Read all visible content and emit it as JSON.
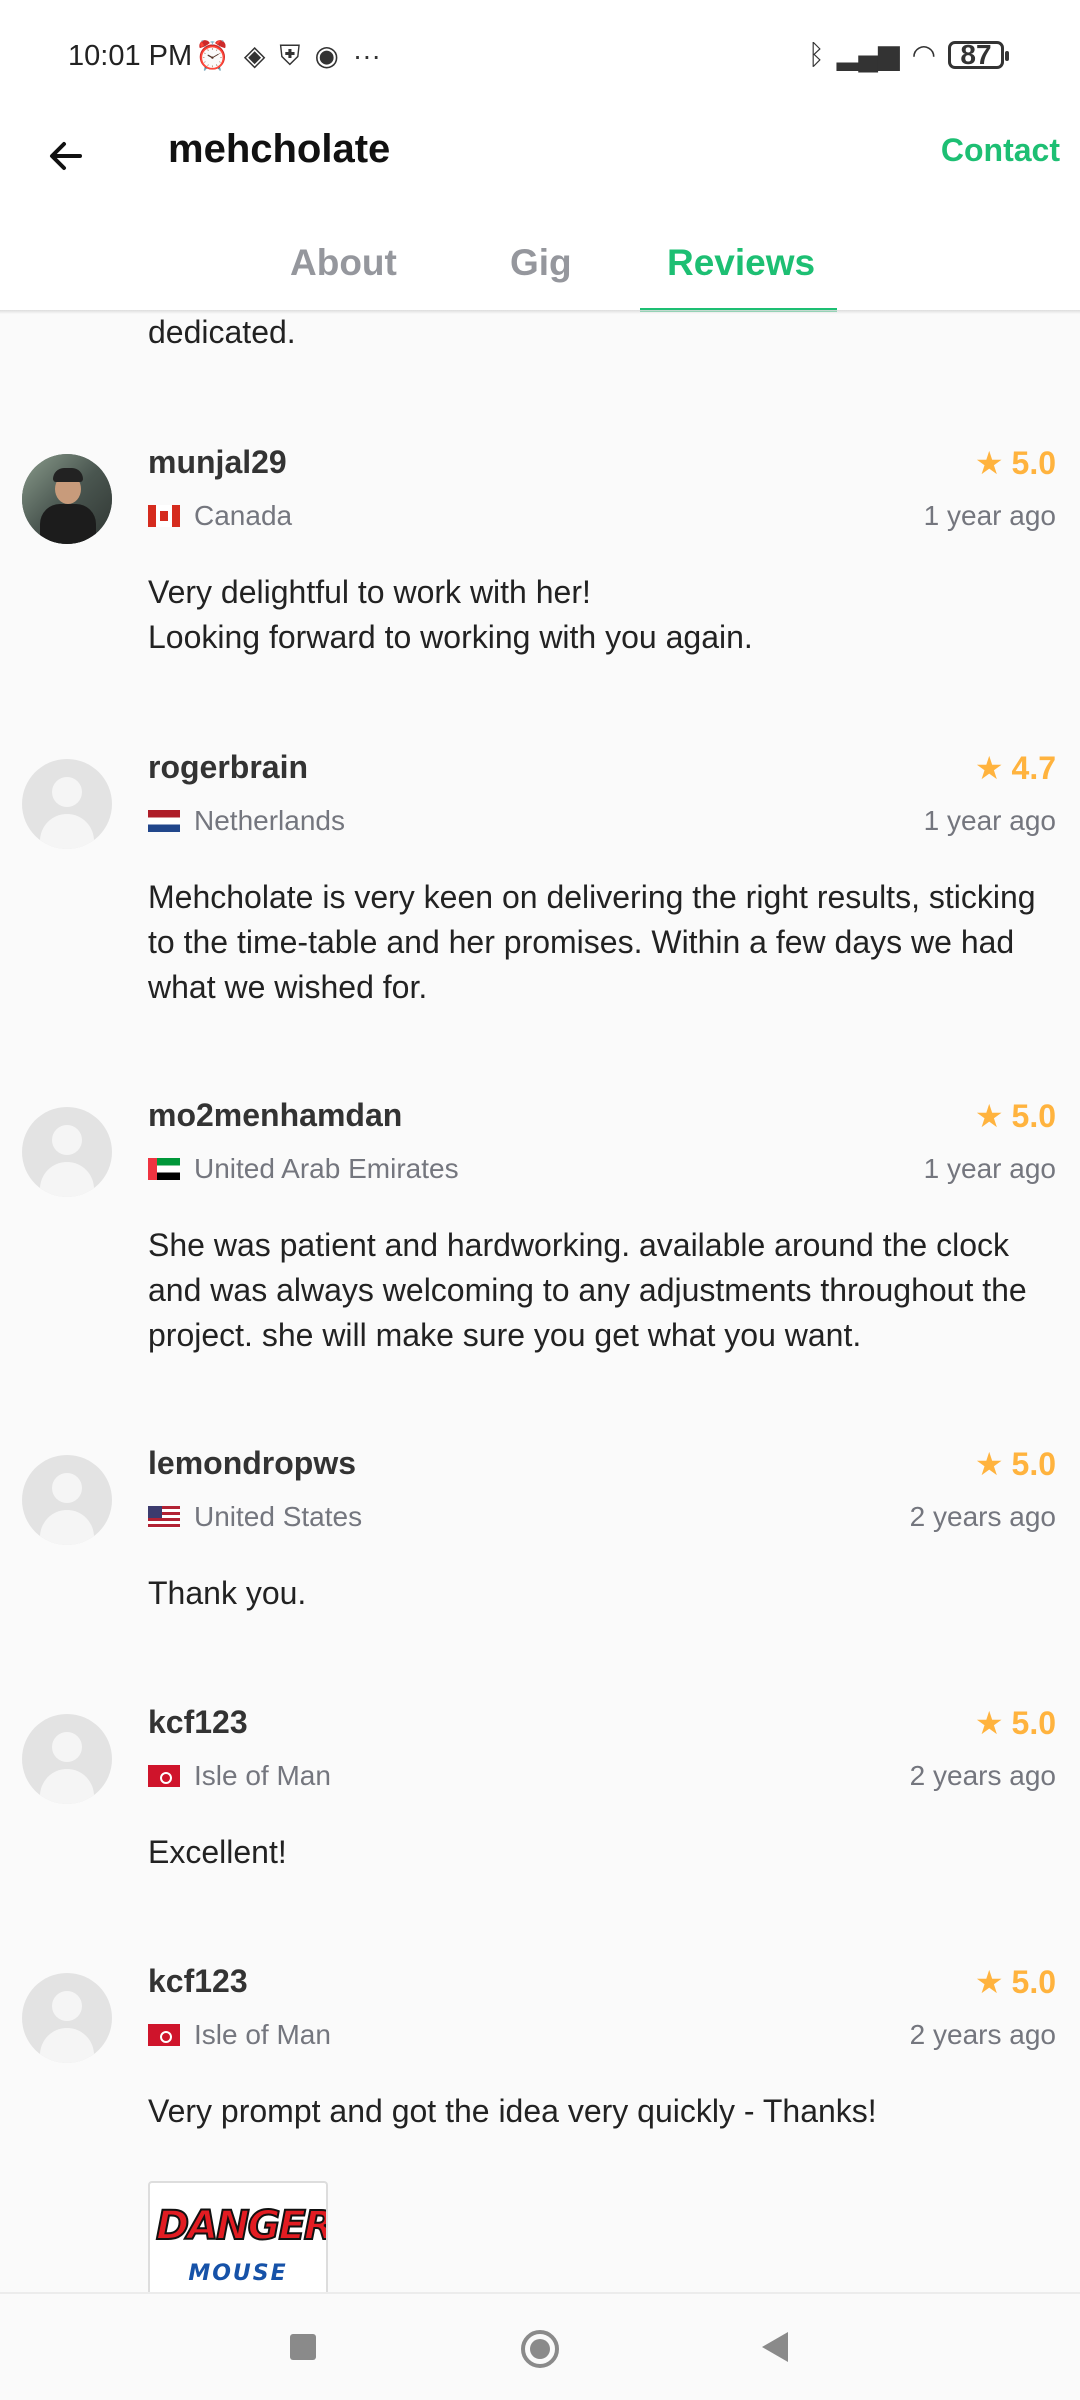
{
  "status_bar": {
    "time": "10:01 PM",
    "battery": "87",
    "icons_left": [
      "alarm-icon",
      "game-controller-icon",
      "shield-icon",
      "media-icon",
      "more-icon"
    ],
    "icons_right": [
      "bluetooth-icon",
      "signal-icon",
      "wifi-icon",
      "battery-icon"
    ]
  },
  "app_bar": {
    "title": "mehcholate",
    "contact_label": "Contact"
  },
  "tabs": [
    {
      "label": "About",
      "active": false
    },
    {
      "label": "Gig",
      "active": false
    },
    {
      "label": "Reviews",
      "active": true
    }
  ],
  "colors": {
    "accent": "#1dbf73",
    "star": "#ffb33e",
    "muted": "#74767e"
  },
  "partial_text": "dedicated.",
  "reviews": [
    {
      "username": "munjal29",
      "rating": "5.0",
      "country": "Canada",
      "time_ago": "1 year ago",
      "text": "Very delightful to work with her!\nLooking forward to working with you again.",
      "avatar": "photo"
    },
    {
      "username": "rogerbrain",
      "rating": "4.7",
      "country": "Netherlands",
      "time_ago": "1 year ago",
      "text": "Mehcholate is very keen on delivering the right results, sticking to the time-table and her promises. Within a few days we had what we wished for.",
      "avatar": "placeholder"
    },
    {
      "username": "mo2menhamdan",
      "rating": "5.0",
      "country": "United Arab Emirates",
      "time_ago": "1 year ago",
      "text": "She was patient and hardworking. available around the clock and was always welcoming to any adjustments throughout the project. she will make sure you get what you want.",
      "avatar": "placeholder"
    },
    {
      "username": "lemondropws",
      "rating": "5.0",
      "country": "United States",
      "time_ago": "2 years ago",
      "text": "Thank you.",
      "avatar": "placeholder"
    },
    {
      "username": "kcf123",
      "rating": "5.0",
      "country": "Isle of Man",
      "time_ago": "2 years ago",
      "text": "Excellent!",
      "avatar": "placeholder"
    },
    {
      "username": "kcf123",
      "rating": "5.0",
      "country": "Isle of Man",
      "time_ago": "2 years ago",
      "text": "Very prompt and got the idea very quickly - Thanks!",
      "avatar": "placeholder",
      "attachment": {
        "logo_line1": "DANGER",
        "logo_line2": "MOUSE"
      }
    }
  ]
}
